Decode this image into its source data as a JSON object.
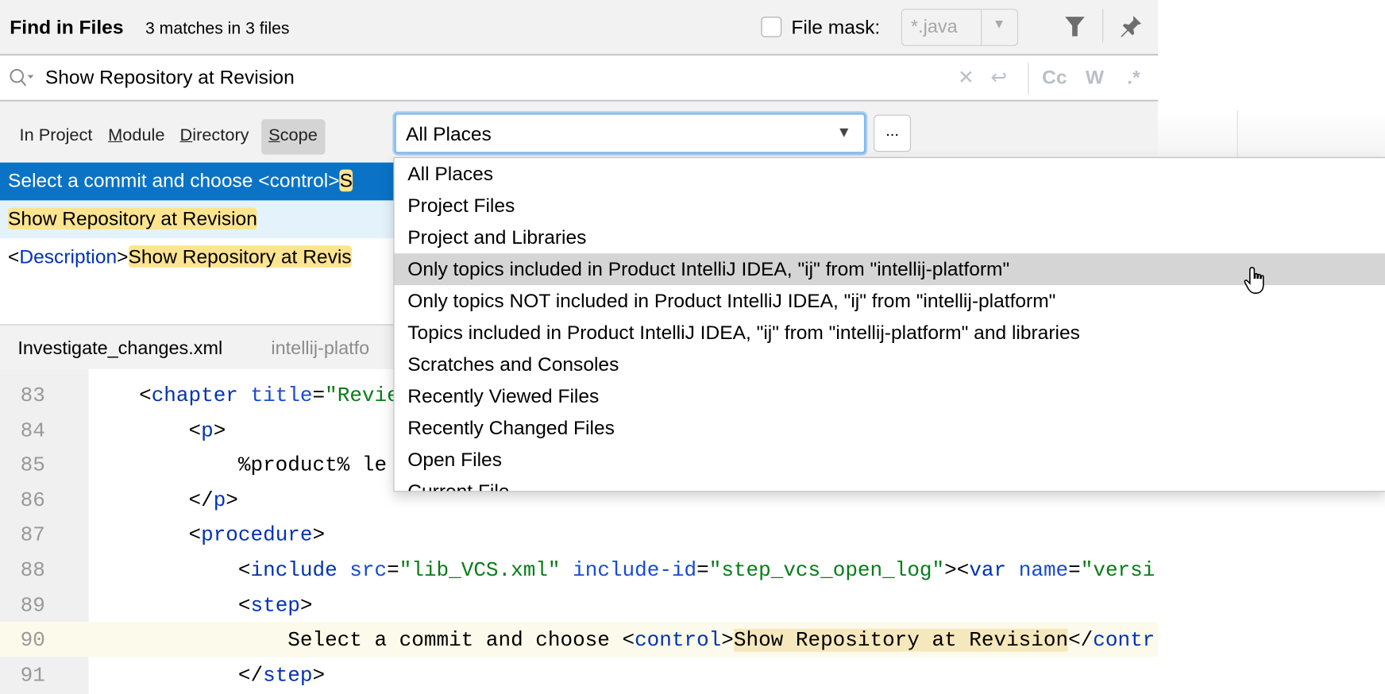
{
  "header": {
    "title": "Find in Files",
    "match_count": "3 matches in 3 files",
    "file_mask_label": "File mask:",
    "file_mask_checked": false,
    "file_mask_value": "*.java"
  },
  "search": {
    "query": "Show Repository at Revision",
    "options": {
      "match_case": "Cc",
      "words": "W",
      "regex": ".*"
    }
  },
  "scope_tabs": [
    {
      "label": "In Project",
      "selected": false
    },
    {
      "label": "Module",
      "selected": false
    },
    {
      "label": "Directory",
      "selected": false
    },
    {
      "label": "Scope",
      "selected": true
    }
  ],
  "scope_combo": {
    "value": "All Places",
    "browse_label": "..."
  },
  "results": [
    {
      "prefix": "Select a commit and choose <control>",
      "match": "S"
    },
    {
      "prefix": "",
      "match": "Show Repository at Revision"
    },
    {
      "tag_open": "<",
      "tag": "Description",
      "tag_close": ">",
      "match": "Show Repository at Revis"
    }
  ],
  "preview": {
    "file_name": "Investigate_changes.xml",
    "file_path": "intellij-platfo",
    "lines": [
      {
        "n": "83"
      },
      {
        "n": "84"
      },
      {
        "n": "85"
      },
      {
        "n": "86"
      },
      {
        "n": "87"
      },
      {
        "n": "88"
      },
      {
        "n": "89"
      },
      {
        "n": "90"
      },
      {
        "n": "91"
      }
    ],
    "code": {
      "l83": [
        "<",
        "chapter",
        " ",
        "title",
        "=",
        "\"Revie"
      ],
      "l84": [
        "<",
        "p",
        ">"
      ],
      "l85": "%product% le",
      "l86": [
        "</",
        "p",
        ">"
      ],
      "l87": [
        "<",
        "procedure",
        ">"
      ],
      "l88": [
        "<",
        "include",
        " ",
        "src",
        "=",
        "\"lib_VCS.xml\"",
        " ",
        "include-id",
        "=",
        "\"step_vcs_open_log\"",
        "><",
        "var",
        " ",
        "name",
        "=",
        "\"versi"
      ],
      "l89": [
        "<",
        "step",
        ">"
      ],
      "l90": [
        "Select a commit and choose <",
        "control",
        ">",
        "Show Repository at Revision",
        "</",
        "contr"
      ],
      "l91": [
        "</",
        "step",
        ">"
      ]
    }
  },
  "scope_popup": {
    "items": [
      "All Places",
      "Project Files",
      "Project and Libraries",
      "Only topics included in Product IntelliJ IDEA, \"ij\" from \"intellij-platform\"",
      "Only topics NOT included in Product IntelliJ IDEA, \"ij\" from \"intellij-platform\"",
      "Topics included in Product IntelliJ IDEA, \"ij\" from \"intellij-platform\" and libraries",
      "Scratches and Consoles",
      "Recently Viewed Files",
      "Recently Changed Files",
      "Open Files",
      "Current File"
    ],
    "hovered_index": 3
  },
  "colors": {
    "selection": "#0a73c6",
    "match_highlight": "#fde48f",
    "tag": "#0033b3",
    "string": "#067d17",
    "focus": "#82b8ec"
  }
}
